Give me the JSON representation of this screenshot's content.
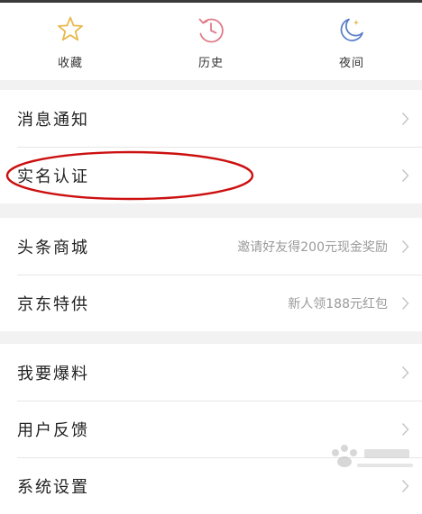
{
  "quick_actions": [
    {
      "label": "收藏",
      "icon": "star-icon",
      "color": "#e8b84a"
    },
    {
      "label": "历史",
      "icon": "history-clock-icon",
      "color": "#e07b8a"
    },
    {
      "label": "夜间",
      "icon": "night-mode-moon-icon",
      "color": "#5a7fc8"
    }
  ],
  "group1": {
    "items": [
      {
        "label": "消息通知"
      },
      {
        "label": "实名认证"
      }
    ]
  },
  "group2": {
    "items": [
      {
        "label": "头条商城",
        "desc": "邀请好友得200元现金奖励"
      },
      {
        "label": "京东特供",
        "desc": "新人领188元红包"
      }
    ]
  },
  "group3": {
    "items": [
      {
        "label": "我要爆料"
      },
      {
        "label": "用户反馈"
      },
      {
        "label": "系统设置"
      }
    ]
  },
  "annotation": {
    "color": "#cc1010"
  }
}
